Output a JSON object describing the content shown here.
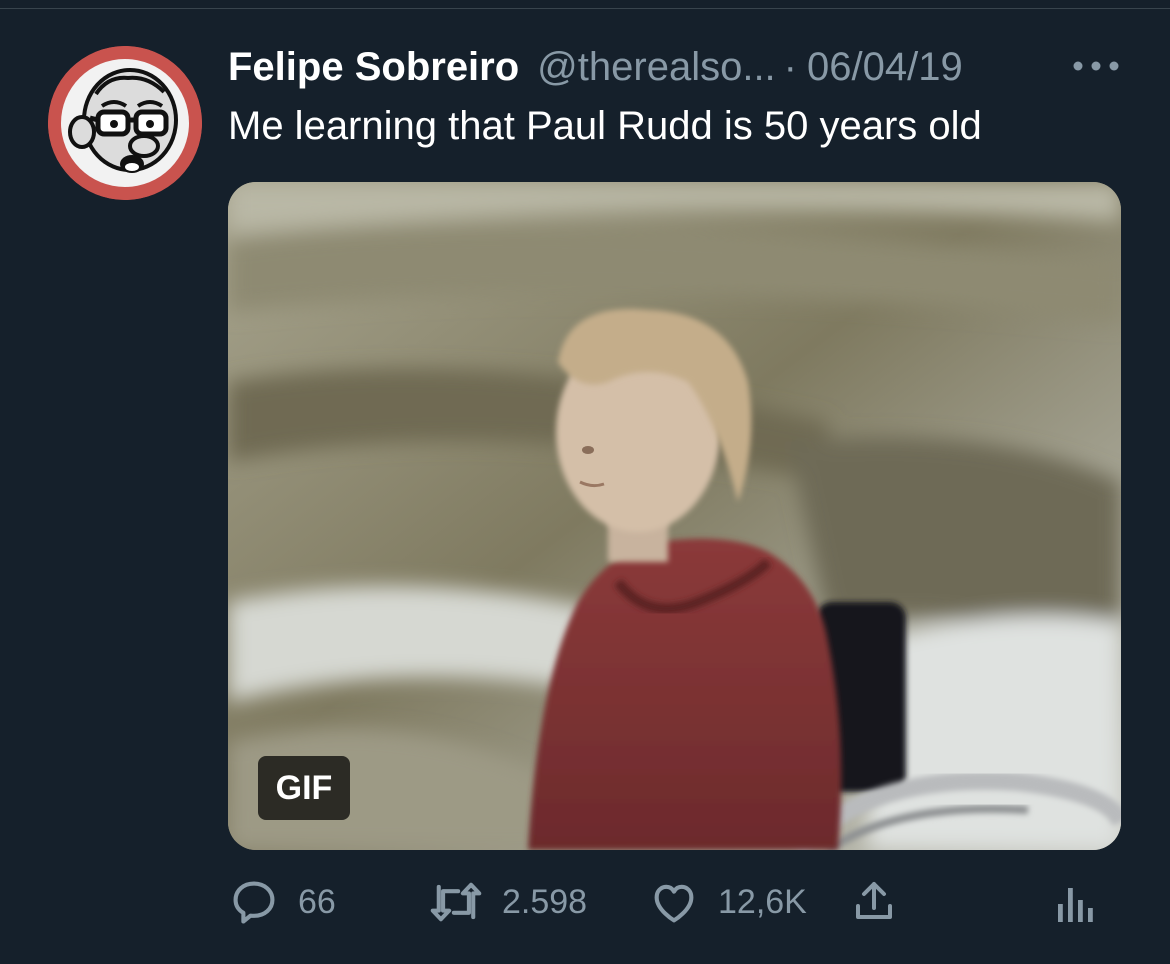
{
  "tweet": {
    "display_name": "Felipe Sobreiro",
    "handle": "@therealso...",
    "separator": "·",
    "date": "06/04/19",
    "text": "Me learning that Paul Rudd is 50 years old",
    "media": {
      "badge": "GIF"
    },
    "actions": {
      "reply_count": "66",
      "retweet_count": "2.598",
      "like_count": "12,6K"
    },
    "icons": [
      "reply-icon",
      "retweet-icon",
      "like-icon",
      "share-icon",
      "analytics-icon",
      "more-icon"
    ]
  },
  "colors": {
    "background": "#15202b",
    "primary_text": "#ffffff",
    "secondary_text": "#8899a6",
    "avatar_ring": "#c9534e"
  }
}
